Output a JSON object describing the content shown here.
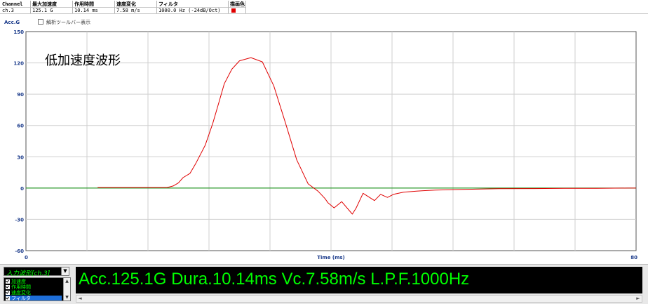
{
  "info_table": {
    "headers": [
      "Channel",
      "最大加速度",
      "作用時間",
      "速度変化",
      "フィルタ",
      "描画色"
    ],
    "values": [
      "ch.3",
      "125.1 G",
      "10.14 ms",
      "7.58 m/s",
      "1000.0 Hz (-24dB/Oct)",
      ""
    ],
    "trace_color": "#e00000"
  },
  "sub_header": {
    "y_axis_label": "Acc.G",
    "analysis_toolbar_label": "解析ツールバー表示"
  },
  "chart_data": {
    "type": "line",
    "title": "低加速度波形",
    "xlabel": "Time (ms)",
    "ylabel": "Acc.G",
    "xlim": [
      0,
      80
    ],
    "ylim": [
      -60,
      150
    ],
    "x_ticks": [
      "0",
      "80"
    ],
    "y_ticks": [
      "150",
      "120",
      "90",
      "60",
      "30",
      "0",
      "-30",
      "-60"
    ],
    "grid": true,
    "series": [
      {
        "color": "#e00000",
        "x": [
          9.4,
          16,
          18.5,
          19.3,
          20,
          20.6,
          21.5,
          22.3,
          23.5,
          24.5,
          25.3,
          26,
          27,
          28,
          29.5,
          31,
          32.5,
          34,
          35.5,
          37,
          38.3,
          39.2,
          39.6,
          40.4,
          41.4,
          42.8,
          43.3,
          44.2,
          45.7,
          46.5,
          47.4,
          48.2,
          49.5,
          51.2,
          52.1,
          53.7,
          57.9,
          62,
          66.4,
          70.6,
          74.8,
          78.9,
          80
        ],
        "values": [
          0.5,
          0.5,
          0.5,
          2,
          5,
          10,
          14,
          24,
          41,
          62,
          82,
          100,
          114,
          122,
          125,
          121,
          98,
          63,
          27,
          4,
          -3,
          -10,
          -14,
          -19,
          -13,
          -25,
          -19,
          -5,
          -12,
          -6,
          -9,
          -6,
          -4,
          -3,
          -2.5,
          -2,
          -1.2,
          -0.6,
          -0.5,
          -0.3,
          -0.2,
          0,
          0
        ]
      },
      {
        "color": "#008800",
        "x": [
          0,
          80
        ],
        "values": [
          0,
          0
        ]
      }
    ]
  },
  "bottom_panel": {
    "channel_select": "入力波形[ch.3]",
    "legend_items": [
      "加速度",
      "作用時間",
      "速度変化",
      "フィルタ"
    ],
    "result_text": "Acc.125.1G Dura.10.14ms Vc.7.58m/s L.P.F.1000Hz"
  }
}
